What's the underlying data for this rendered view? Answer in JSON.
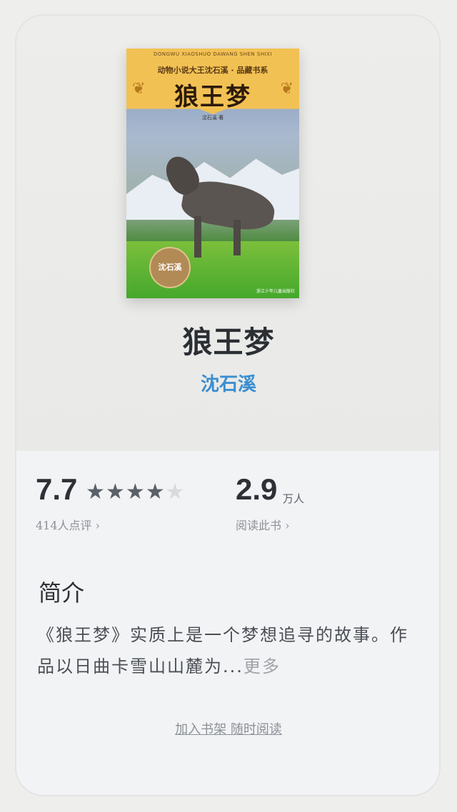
{
  "cover": {
    "pinyin": "DONGWU XIAOSHUO DAWANG SHEN SHIXI",
    "series": "动物小说大王沈石溪 · 品藏书系",
    "title": "狼王梦",
    "author_small": "沈石溪 著",
    "seal": "沈石溪",
    "publisher": "浙江少年儿童出版社"
  },
  "book": {
    "title": "狼王梦",
    "author": "沈石溪"
  },
  "stats": {
    "rating": "7.7",
    "stars_filled": 4,
    "stars_total": 5,
    "rating_count": "414人点评",
    "readers": "2.9",
    "readers_unit": "万人",
    "readers_link": "阅读此书"
  },
  "intro": {
    "heading": "简介",
    "text": "《狼王梦》实质上是一个梦想追寻的故事。作品以日曲卡雪山山麓为...",
    "more": "更多"
  },
  "actions": {
    "shelf": "加入书架 随时阅读"
  }
}
